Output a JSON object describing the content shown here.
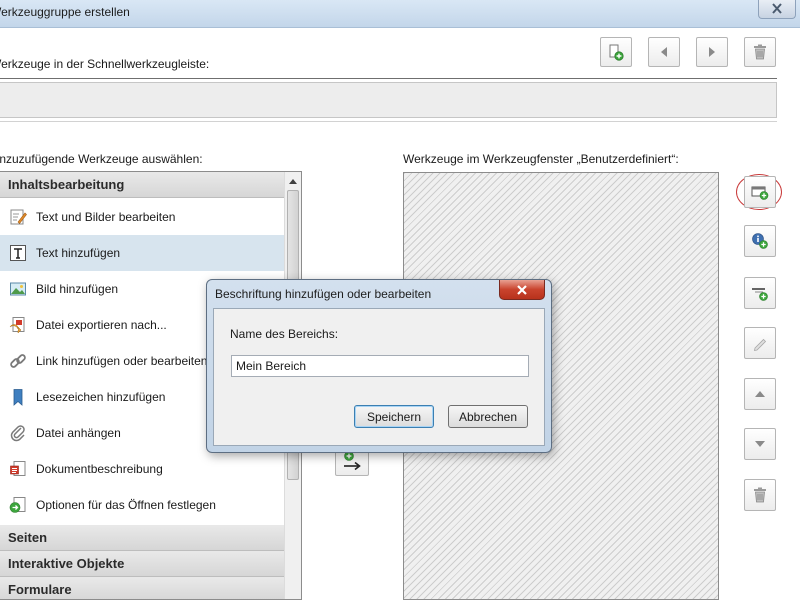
{
  "window": {
    "title": "Werkzeuggruppe erstellen"
  },
  "top": {
    "quickbar_label": "Werkzeuge in der Schnellwerkzeugleiste:"
  },
  "left": {
    "header": "Hinzuzufügende Werkzeuge auswählen:",
    "categories": [
      "Inhaltsbearbeitung",
      "Seiten",
      "Interaktive Objekte",
      "Formulare"
    ],
    "items": [
      {
        "label": "Text und Bilder bearbeiten",
        "icon": "edit-text-image-icon",
        "selected": false
      },
      {
        "label": "Text hinzufügen",
        "icon": "add-text-icon",
        "selected": true
      },
      {
        "label": "Bild hinzufügen",
        "icon": "add-image-icon",
        "selected": false
      },
      {
        "label": "Datei exportieren nach...",
        "icon": "export-file-icon",
        "selected": false
      },
      {
        "label": "Link hinzufügen oder bearbeiten",
        "icon": "link-icon",
        "selected": false
      },
      {
        "label": "Lesezeichen hinzufügen",
        "icon": "bookmark-icon",
        "selected": false
      },
      {
        "label": "Datei anhängen",
        "icon": "paperclip-icon",
        "selected": false
      },
      {
        "label": "Dokumentbeschreibung",
        "icon": "document-description-icon",
        "selected": false
      },
      {
        "label": "Optionen für das Öffnen festlegen",
        "icon": "open-options-icon",
        "selected": false
      }
    ]
  },
  "right": {
    "header": "Werkzeuge im Werkzeugfenster „Benutzerdefiniert“:"
  },
  "dialog": {
    "title": "Beschriftung hinzufügen oder bearbeiten",
    "field_label": "Name des Bereichs:",
    "field_value": "Mein Bereich",
    "save_label": "Speichern",
    "cancel_label": "Abbrechen"
  },
  "colors": {
    "selection": "#d7e4ee",
    "highlight_ring": "#c93a3a",
    "close_button": "#c9432d",
    "add_green": "#3da63d"
  }
}
